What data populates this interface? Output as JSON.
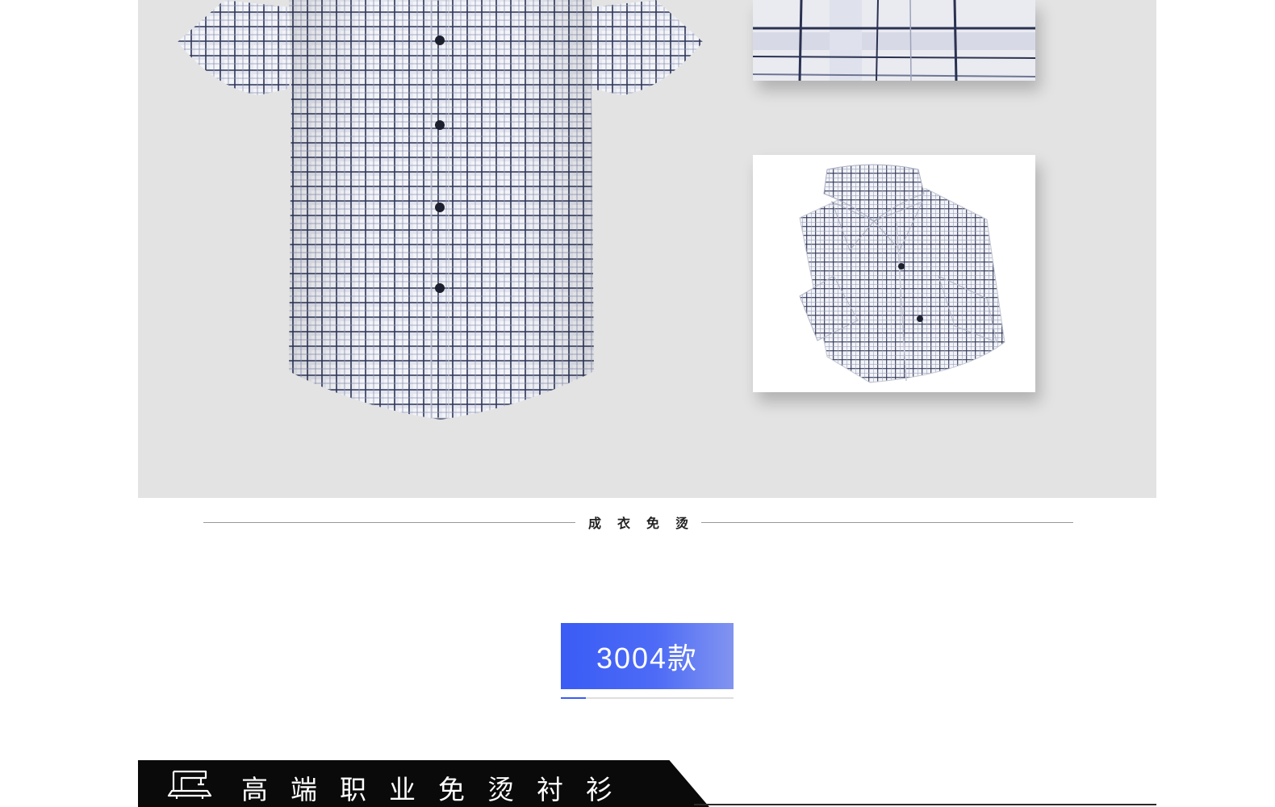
{
  "product_panel": {
    "main_image_icon": "shirt-front-image",
    "thumbnails": [
      {
        "icon": "fabric-closeup-image"
      },
      {
        "icon": "folded-shirt-image"
      }
    ]
  },
  "caption": {
    "text": "成衣免烫"
  },
  "model_badge": {
    "label": "3004款",
    "color_start": "#3a5cf5",
    "color_end": "#8294f0"
  },
  "section_banner": {
    "icon": "sewing-machine-icon",
    "title": "高端职业免烫衬衫",
    "background": "#0a0a0a"
  }
}
